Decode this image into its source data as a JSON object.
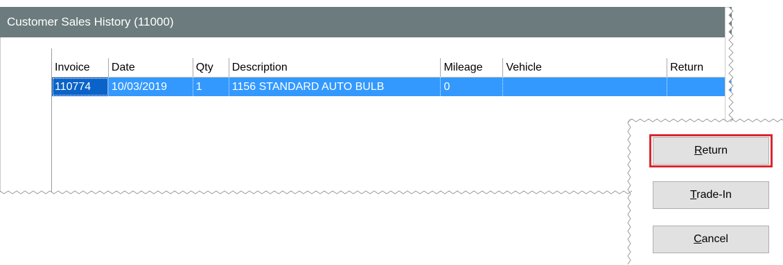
{
  "window": {
    "title": "Customer Sales History (11000)"
  },
  "grid": {
    "columns": [
      "Invoice",
      "Date",
      "Qty",
      "Description",
      "Mileage",
      "Vehicle",
      "Return"
    ],
    "rows": [
      [
        "110774",
        "10/03/2019",
        "1",
        "1156 STANDARD AUTO BULB",
        "0",
        "",
        ""
      ]
    ]
  },
  "buttons": {
    "return": {
      "accel": "R",
      "rest": "eturn"
    },
    "trade_in": {
      "accel": "T",
      "rest": "rade-In"
    },
    "cancel": {
      "accel": "C",
      "rest": "ancel"
    }
  },
  "colors": {
    "titlebar": "#6c7b7d",
    "selection": "#3399ff",
    "focused_cell": "#0a63c9",
    "highlight_box": "#d9272e"
  }
}
